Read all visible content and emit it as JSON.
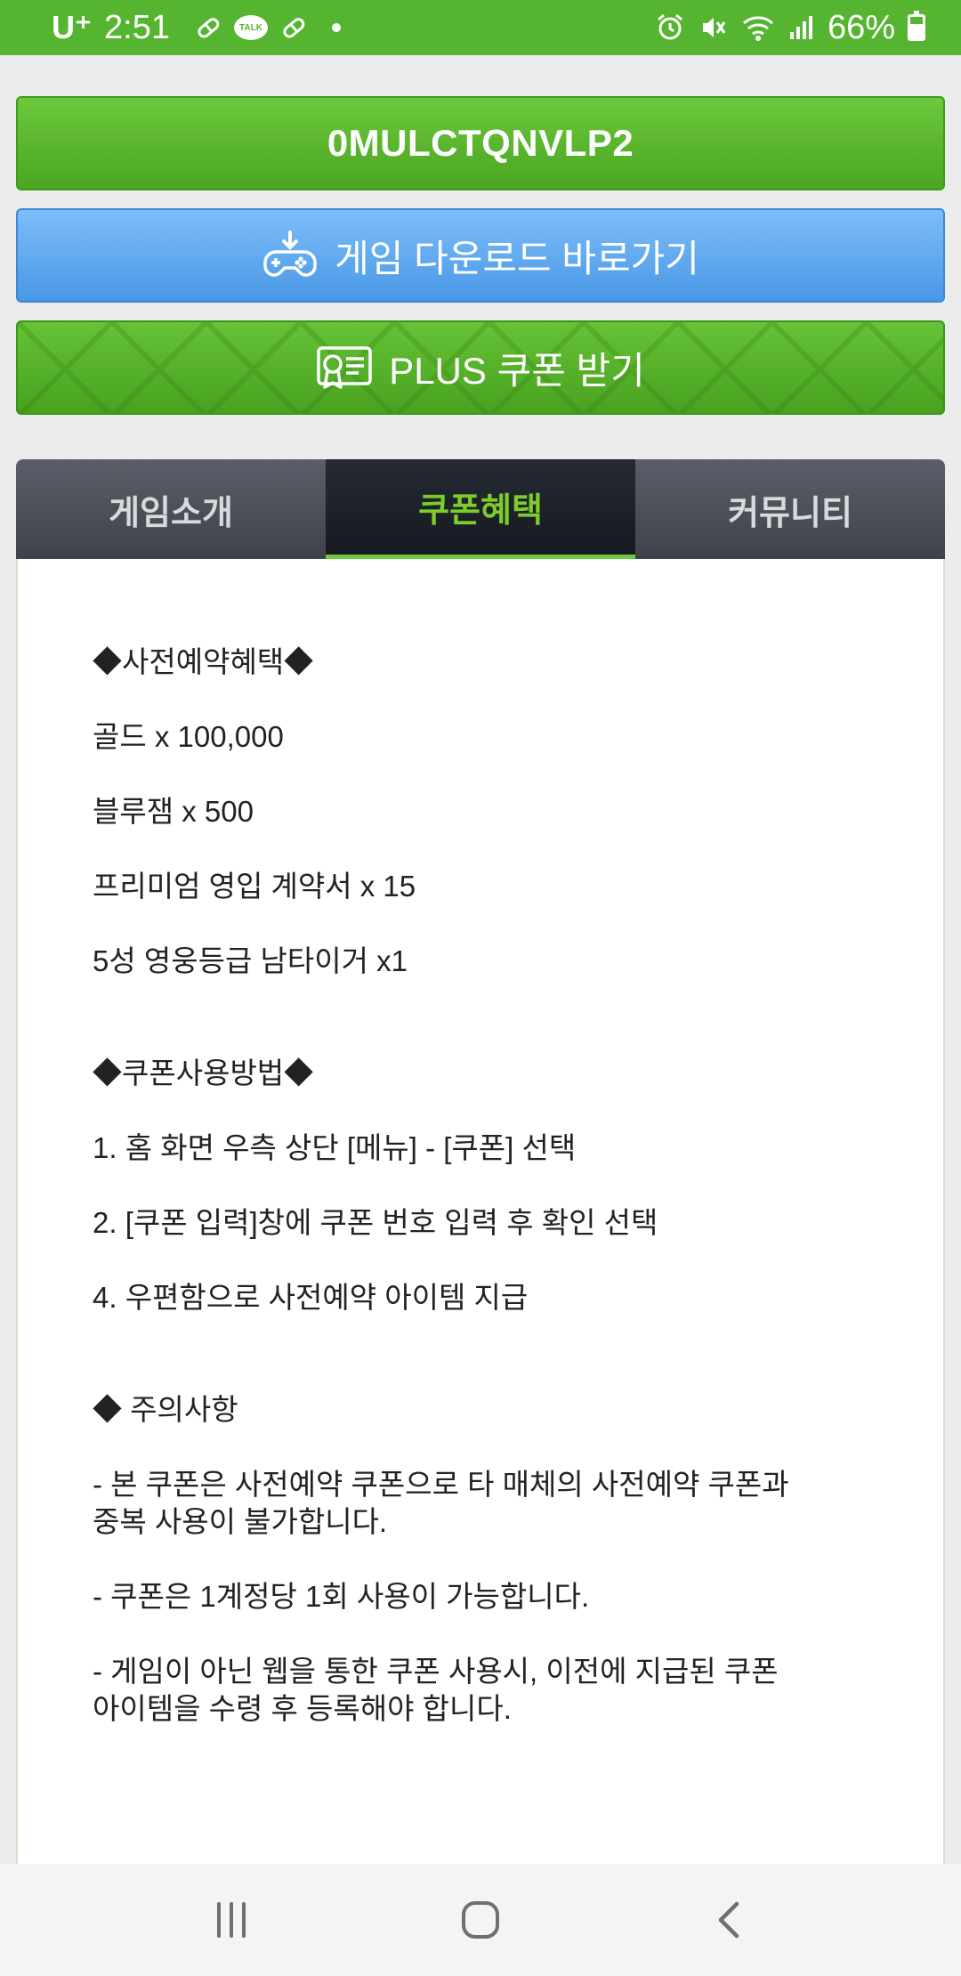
{
  "status_bar": {
    "carrier": "U⁺",
    "time": "2:51",
    "battery": "66%",
    "talk_badge": "TALK",
    "icons": [
      "pill-icon",
      "kakaotalk-icon",
      "pill-icon",
      "dot-icon",
      "alarm-icon",
      "mute-icon",
      "wifi-icon",
      "signal-icon",
      "battery-icon"
    ]
  },
  "buttons": {
    "coupon_code": "0MULCTQNVLP2",
    "download": "게임 다운로드 바로가기",
    "plus_coupon": "PLUS 쿠폰 받기"
  },
  "tabs": [
    {
      "label": "게임소개",
      "active": false
    },
    {
      "label": "쿠폰혜택",
      "active": true
    },
    {
      "label": "커뮤니티",
      "active": false
    }
  ],
  "content": {
    "preorder_title": "◆사전예약혜택◆",
    "rewards": [
      "골드 x 100,000",
      "블루잼 x 500",
      "프리미엄 영입 계약서 x 15",
      "5성 영웅등급 남타이거 x1"
    ],
    "usage_title": "◆쿠폰사용방법◆",
    "usage_steps": [
      "1. 홈 화면 우측 상단 [메뉴] - [쿠폰] 선택",
      "2. [쿠폰 입력]창에 쿠폰 번호 입력 후 확인 선택",
      "4. 우편함으로 사전예약 아이템 지급"
    ],
    "notice_title": "◆ 주의사항",
    "notices": [
      {
        "line1": "- 본 쿠폰은 사전예약 쿠폰으로 타 매체의 사전예약 쿠폰과",
        "line2": "중복 사용이 불가합니다."
      },
      {
        "line1": "- 쿠폰은 1계정당 1회 사용이 가능합니다.",
        "line2": ""
      },
      {
        "line1": "- 게임이 아닌 웹을 통한 쿠폰 사용시, 이전에 지급된 쿠폰",
        "line2": "아이템을 수령 후 등록해야 합니다."
      }
    ]
  },
  "nav_bar": {
    "icons": [
      "recent-apps-icon",
      "home-icon",
      "back-icon"
    ]
  },
  "colors": {
    "status_bar": "#55b531",
    "green_button": "#55b531",
    "blue_button": "#5aa6ee",
    "active_tab_text": "#7ccd2b",
    "tab_bar": "#474b54"
  }
}
